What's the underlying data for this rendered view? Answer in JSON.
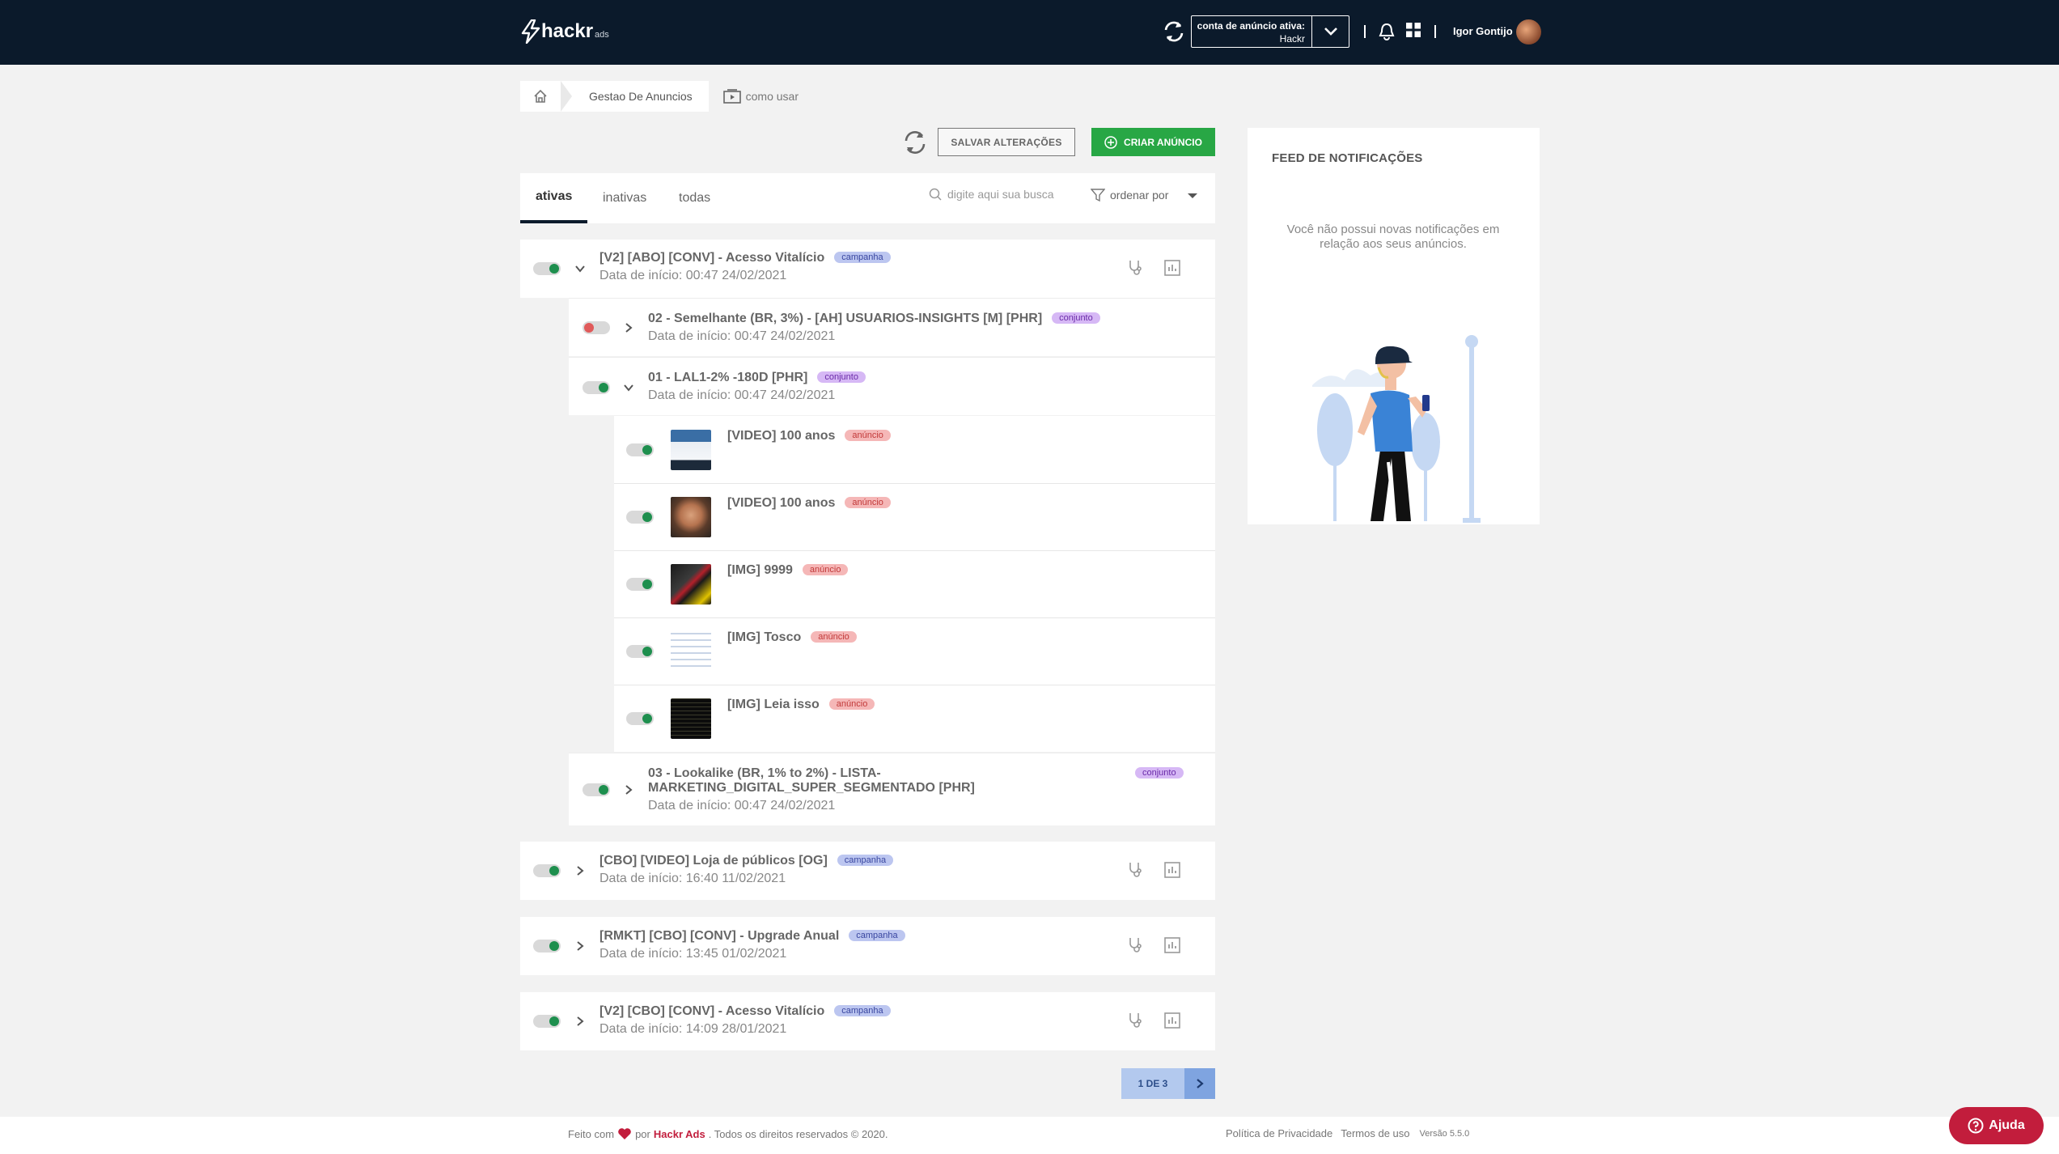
{
  "header": {
    "logo_text": "hackr",
    "logo_sub": "ads",
    "account_label": "conta de anúncio ativa:",
    "account_name": "Hackr",
    "user_name": "Igor Gontijo"
  },
  "breadcrumb": {
    "current": "Gestao De Anuncios",
    "how_to": "como usar"
  },
  "toolbar": {
    "save_label": "SALVAR ALTERAÇÕES",
    "create_label": "CRIAR ANÚNCIO"
  },
  "tabs": [
    {
      "label": "ativas",
      "active": true
    },
    {
      "label": "inativas",
      "active": false
    },
    {
      "label": "todas",
      "active": false
    }
  ],
  "search": {
    "placeholder": "digite aqui sua busca"
  },
  "order_by": {
    "label": "ordenar por"
  },
  "campaigns": [
    {
      "title": "[V2] [ABO] [CONV] - Acesso Vitalício",
      "badge": "campanha",
      "date": "Data de início: 00:47 24/02/2021",
      "active": true,
      "expanded": true,
      "sets": [
        {
          "title": "02 - Semelhante (BR, 3%) - [AH] USUARIOS-INSIGHTS [M] [PHR]",
          "badge": "conjunto",
          "date": "Data de início: 00:47 24/02/2021",
          "active": false,
          "expanded": false
        },
        {
          "title": "01 - LAL1-2% -180D [PHR]",
          "badge": "conjunto",
          "date": "Data de início: 00:47 24/02/2021",
          "active": true,
          "expanded": true,
          "ads": [
            {
              "title": "[VIDEO] 100 anos",
              "badge": "anúncio",
              "active": true
            },
            {
              "title": "[VIDEO] 100 anos",
              "badge": "anúncio",
              "active": true
            },
            {
              "title": "[IMG] 9999",
              "badge": "anúncio",
              "active": true
            },
            {
              "title": "[IMG] Tosco",
              "badge": "anúncio",
              "active": true
            },
            {
              "title": "[IMG] Leia isso",
              "badge": "anúncio",
              "active": true
            }
          ]
        },
        {
          "title_line1": "03 - Lookalike (BR, 1% to 2%) - LISTA-",
          "title_line2": "MARKETING_DIGITAL_SUPER_SEGMENTADO [PHR]",
          "badge": "conjunto",
          "date": "Data de início: 00:47 24/02/2021",
          "active": true,
          "expanded": false
        }
      ]
    },
    {
      "title": "[CBO] [VIDEO] Loja de públicos [OG]",
      "badge": "campanha",
      "date": "Data de início: 16:40 11/02/2021",
      "active": true,
      "expanded": false
    },
    {
      "title": "[RMKT] [CBO] [CONV] - Upgrade Anual",
      "badge": "campanha",
      "date": "Data de início: 13:45 01/02/2021",
      "active": true,
      "expanded": false
    },
    {
      "title": "[V2] [CBO] [CONV] - Acesso Vitalício",
      "badge": "campanha",
      "date": "Data de início: 14:09 28/01/2021",
      "active": true,
      "expanded": false
    }
  ],
  "pagination": {
    "label": "1 DE 3"
  },
  "notifications": {
    "title": "FEED DE NOTIFICAÇÕES",
    "empty_text": "Você não possui novas notificações em relação aos seus anúncios."
  },
  "footer": {
    "made_with": "Feito com",
    "by": "por",
    "brand": "Hackr Ads",
    "rights": ". Todos os direitos reservados © 2020.",
    "privacy": "Política de Privacidade",
    "terms": "Termos de uso",
    "version": "Versão 5.5.0"
  },
  "help": {
    "label": "Ajuda"
  },
  "colors": {
    "topbar": "#0b1a2b",
    "primary_green": "#28a745",
    "brand_red": "#c21d3c",
    "toggle_on": "#1e8f4e",
    "toggle_off": "#e05a5a"
  }
}
